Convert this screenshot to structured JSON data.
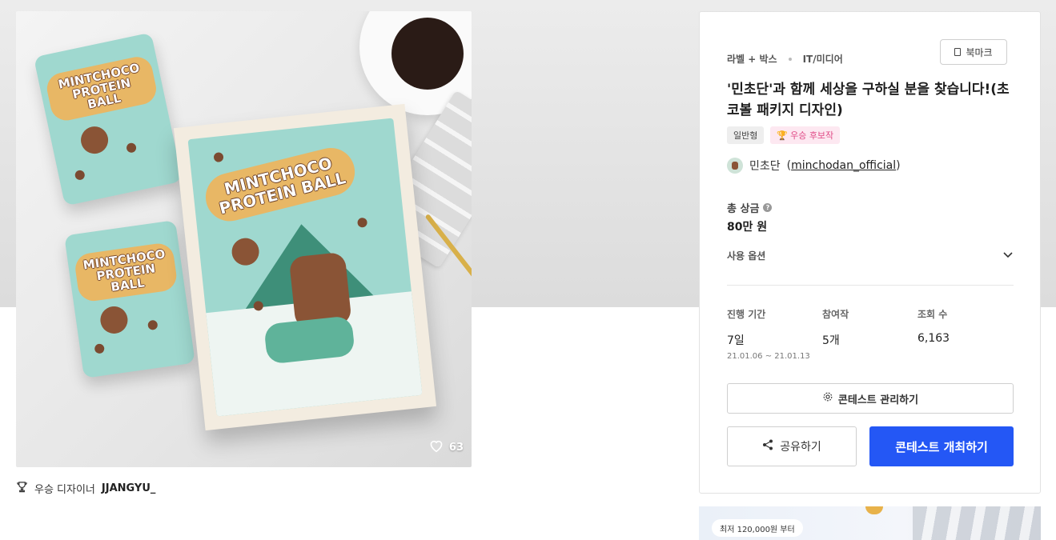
{
  "hero": {
    "pouch_text": "MINTCHOCO PROTEIN BALL",
    "box_text": "MINTCHOCO PROTEIN BALL",
    "likes": "63"
  },
  "winner": {
    "label": "우승 디자이너",
    "name": "JJANGYU_"
  },
  "panel": {
    "bookmark_label": "북마크",
    "categories": [
      "라벨 + 박스",
      "IT/미디어"
    ],
    "title": "'민초단'과 함께 세상을 구하실 분을 찾습니다!(초코볼 패키지 디자인)",
    "badges": [
      "일반형",
      "우승 후보작"
    ],
    "host_name": "민초단",
    "host_handle": "minchodan_official",
    "prize_label": "총 상금",
    "prize_help": "?",
    "prize_value": "80만 원",
    "usage_label": "사용 옵션",
    "stats": [
      {
        "label": "진행 기간",
        "value": "7일",
        "sub": "21.01.06 ~ 21.01.13"
      },
      {
        "label": "참여작",
        "value": "5개"
      },
      {
        "label": "조회 수",
        "value": "6,163"
      }
    ],
    "manage_label": "콘테스트 관리하기",
    "share_label": "공유하기",
    "host_label": "콘테스트 개최하기"
  },
  "promo": {
    "pill": "최저 120,000원 부터"
  },
  "colors": {
    "primary": "#2457f5",
    "candidate_badge": "#e04a86",
    "mint": "#9fd8cf"
  }
}
